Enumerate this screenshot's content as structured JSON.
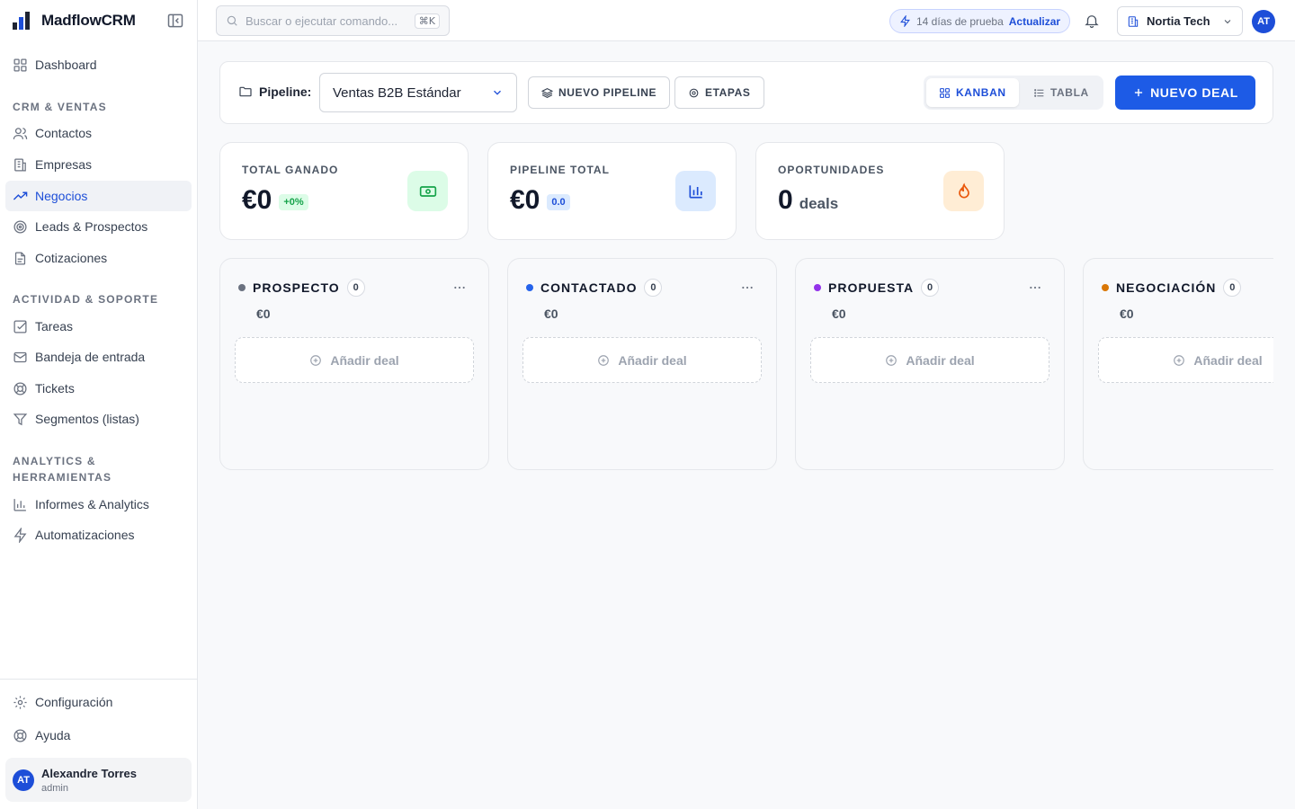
{
  "app": {
    "name": "MadflowCRM"
  },
  "sidebar": {
    "items": [
      {
        "label": "Dashboard",
        "icon": "dashboard-icon"
      },
      {
        "label": "Contactos",
        "icon": "users-icon"
      },
      {
        "label": "Empresas",
        "icon": "building-icon"
      },
      {
        "label": "Negocios",
        "icon": "trending-up-icon",
        "active": true
      },
      {
        "label": "Leads & Prospectos",
        "icon": "target-icon"
      },
      {
        "label": "Cotizaciones",
        "icon": "file-icon"
      },
      {
        "label": "Tareas",
        "icon": "checkbox-icon"
      },
      {
        "label": "Bandeja de entrada",
        "icon": "mail-icon"
      },
      {
        "label": "Tickets",
        "icon": "lifebuoy-icon"
      },
      {
        "label": "Segmentos (listas)",
        "icon": "filter-icon"
      },
      {
        "label": "Informes & Analytics",
        "icon": "bar-chart-icon"
      },
      {
        "label": "Automatizaciones",
        "icon": "zap-icon"
      },
      {
        "label": "Configuración",
        "icon": "gear-icon"
      },
      {
        "label": "Ayuda",
        "icon": "help-icon"
      }
    ],
    "sections": {
      "crm": "CRM & VENTAS",
      "activity": "ACTIVIDAD & SOPORTE",
      "analytics": "ANALYTICS & HERRAMIENTAS"
    },
    "user": {
      "initials": "AT",
      "name": "Alexandre Torres",
      "role": "admin"
    }
  },
  "header": {
    "search_placeholder": "Buscar o ejecutar comando...",
    "shortcut": "⌘K",
    "trial_text": "14 días de prueba",
    "upgrade_label": "Actualizar",
    "org_name": "Nortia Tech",
    "avatar_initials": "AT"
  },
  "toolbar": {
    "pipeline_label": "Pipeline:",
    "pipeline_value": "Ventas B2B Estándar",
    "new_pipeline_label": "NUEVO PIPELINE",
    "stages_label": "ETAPAS",
    "kanban_label": "KANBAN",
    "table_label": "TABLA",
    "active_view": "kanban",
    "new_deal_label": "NUEVO DEAL"
  },
  "kpis": [
    {
      "title": "TOTAL GANADO",
      "value": "€0",
      "badge": "+0%",
      "badge_color": "#16a34a",
      "badge_bg": "#dcfce7",
      "icon": "money-icon",
      "icon_color": "#16a34a",
      "icon_bg": "#dcfce7"
    },
    {
      "title": "PIPELINE TOTAL",
      "value": "€0",
      "badge": "0.0",
      "badge_color": "#1d4ed8",
      "badge_bg": "#dbeafe",
      "icon": "bar-chart-icon",
      "icon_color": "#1d4ed8",
      "icon_bg": "#dbeafe"
    },
    {
      "title": "OPORTUNIDADES",
      "value": "0",
      "unit": "deals",
      "icon": "flame-icon",
      "icon_color": "#ea580c",
      "icon_bg": "#ffedd5"
    }
  ],
  "columns": [
    {
      "title": "PROSPECTO",
      "count": "0",
      "amount": "€0",
      "dot_color": "#6b7280",
      "add_label": "Añadir deal"
    },
    {
      "title": "CONTACTADO",
      "count": "0",
      "amount": "€0",
      "dot_color": "#2563eb",
      "add_label": "Añadir deal"
    },
    {
      "title": "PROPUESTA",
      "count": "0",
      "amount": "€0",
      "dot_color": "#9333ea",
      "add_label": "Añadir deal"
    },
    {
      "title": "NEGOCIACIÓN",
      "count": "0",
      "amount": "€0",
      "dot_color": "#d97706",
      "add_label": "Añadir deal"
    }
  ]
}
